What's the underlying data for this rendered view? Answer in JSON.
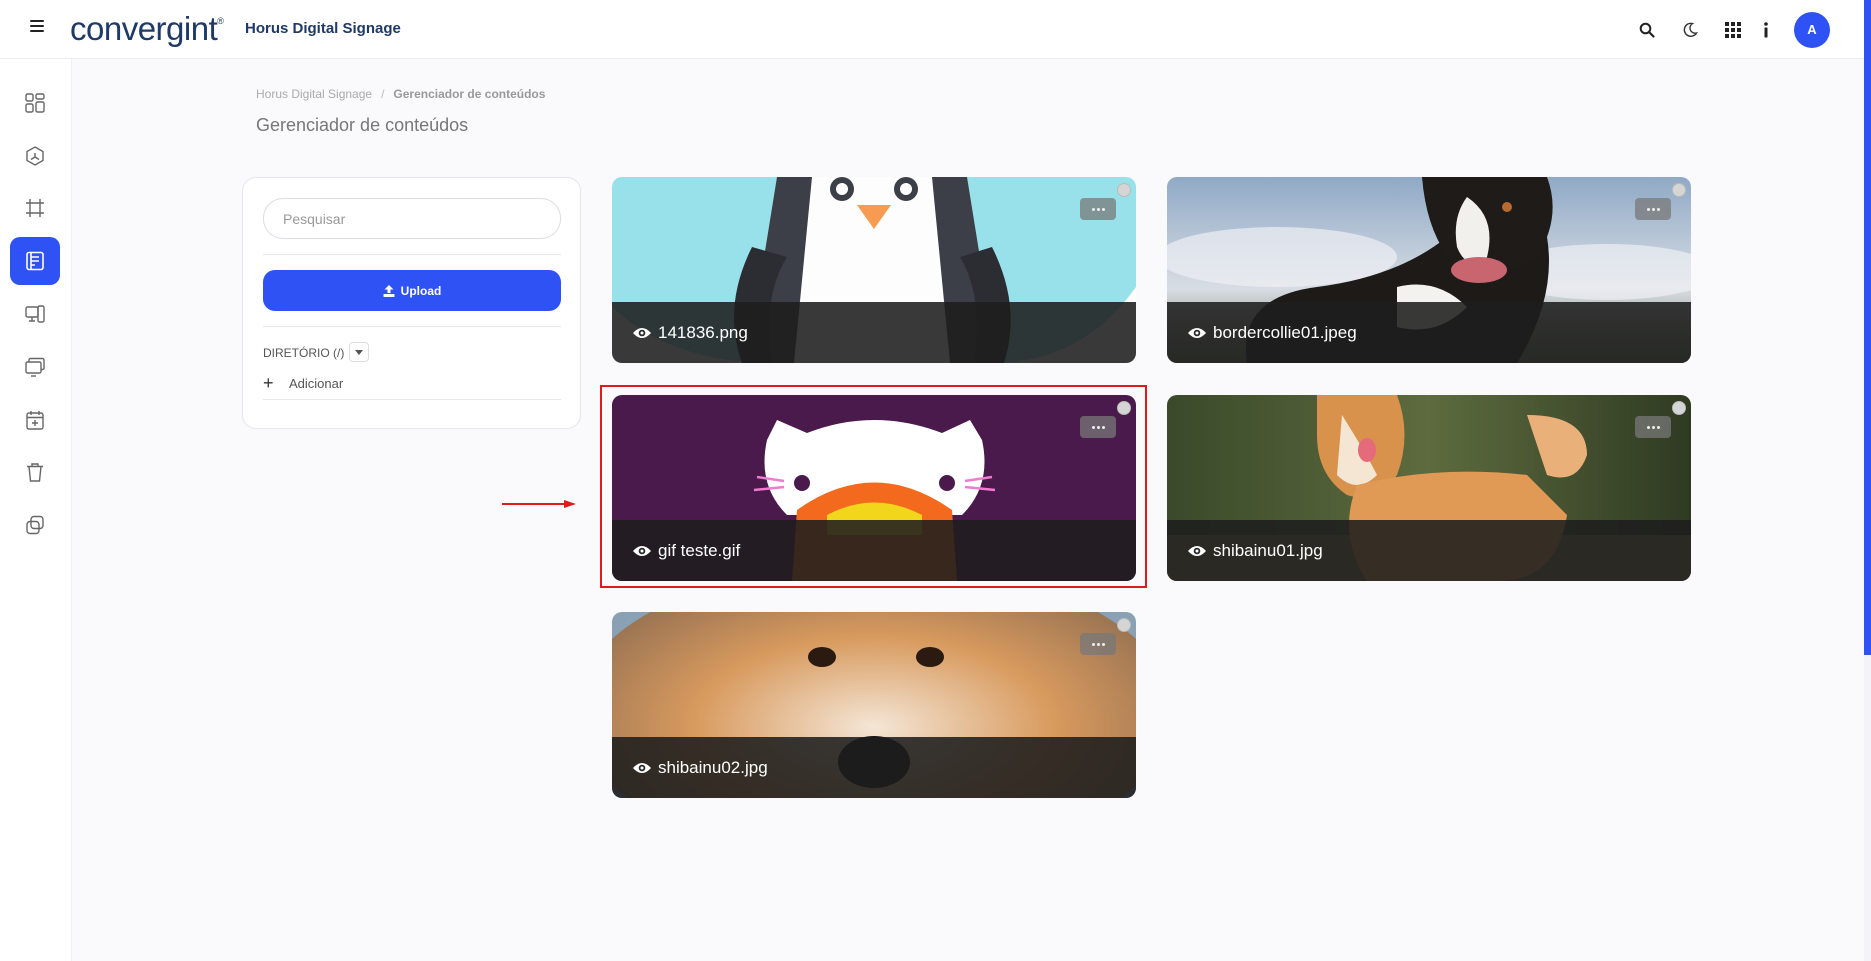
{
  "header": {
    "logo_text": "convergint",
    "app_title": "Horus Digital Signage",
    "avatar_initial": "A",
    "icons": [
      "menu-icon",
      "search-icon",
      "moon-icon",
      "apps-grid-icon",
      "info-icon"
    ]
  },
  "sidebar": {
    "items": [
      {
        "name": "dashboard-icon",
        "active": false
      },
      {
        "name": "cube-icon",
        "active": false
      },
      {
        "name": "frame-icon",
        "active": false
      },
      {
        "name": "content-icon",
        "active": true
      },
      {
        "name": "devices-icon",
        "active": false
      },
      {
        "name": "screens-icon",
        "active": false
      },
      {
        "name": "calendar-add-icon",
        "active": false
      },
      {
        "name": "trash-icon",
        "active": false
      },
      {
        "name": "copy-icon",
        "active": false
      }
    ]
  },
  "breadcrumb": {
    "root": "Horus Digital Signage",
    "separator": "/",
    "current": "Gerenciador de conteúdos"
  },
  "page_title": "Gerenciador de conteúdos",
  "panel": {
    "search_placeholder": "Pesquisar",
    "search_value": "",
    "upload_label": "Upload",
    "directory_label": "DIRETÓRIO (/)",
    "add_label": "Adicionar"
  },
  "cards": [
    {
      "filename": "141836.png",
      "thumbnail": "penguin-illustration"
    },
    {
      "filename": "bordercollie01.jpeg",
      "thumbnail": "border-collie-photo"
    },
    {
      "filename": "gif teste.gif",
      "thumbnail": "cat-illustration"
    },
    {
      "filename": "shibainu01.jpg",
      "thumbnail": "shiba-inu-photo"
    },
    {
      "filename": "shibainu02.jpg",
      "thumbnail": "shiba-inu-face-photo"
    }
  ],
  "colors": {
    "accent": "#2f52f5",
    "highlight": "#e01b1b",
    "brand": "#1f3a66"
  }
}
